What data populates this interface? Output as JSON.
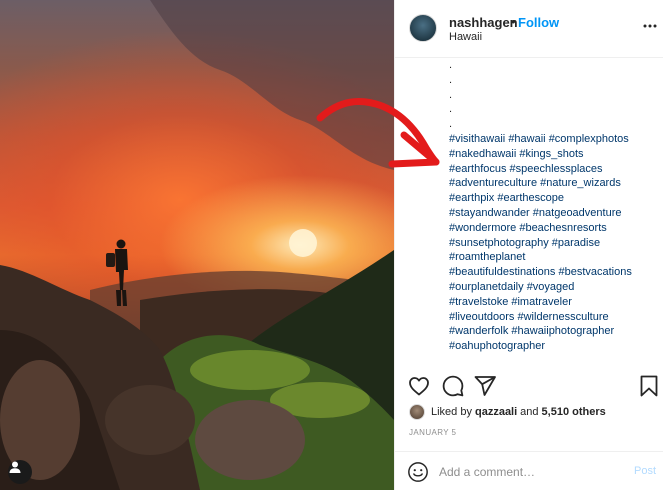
{
  "post": {
    "photo_icon": "user-icon",
    "header": {
      "username": "nashhagen",
      "separator": "•",
      "follow_label": "Follow",
      "location": "Hawaii",
      "more_icon": "more-horizontal-icon"
    },
    "caption": {
      "bullets": [
        ".",
        ".",
        ".",
        ".",
        "."
      ],
      "hashtag_lines": [
        [
          "#visithawaii",
          "#hawaii",
          "#complexphotos"
        ],
        [
          "#nakedhawaii",
          "#kings_shots"
        ],
        [
          "#earthfocus",
          "#speechlessplaces"
        ],
        [
          "#adventureculture",
          "#nature_wizards"
        ],
        [
          "#earthpix",
          "#earthescope"
        ],
        [
          "#stayandwander",
          "#natgeoadventure"
        ],
        [
          "#wondermore",
          "#beachesnresorts"
        ],
        [
          "#sunsetphotography",
          "#paradise"
        ],
        [
          "#roamtheplanet"
        ],
        [
          "#beautifuldestinations",
          "#bestvacations"
        ],
        [
          "#ourplanetdaily",
          "#voyaged"
        ],
        [
          "#travelstoke",
          "#imatraveler"
        ],
        [
          "#liveoutdoors",
          "#wildernessculture"
        ],
        [
          "#wanderfolk",
          "#hawaiiphotographer"
        ],
        [
          "#oahuphotographer"
        ]
      ]
    },
    "actions": {
      "like_icon": "heart-icon",
      "comment_icon": "comment-icon",
      "share_icon": "send-icon",
      "save_icon": "bookmark-icon"
    },
    "likes": {
      "prefix": "Liked by",
      "user": "qazzaali",
      "joiner": "and",
      "others": "5,510 others"
    },
    "date": "JANUARY 5",
    "comment": {
      "emoji_icon": "smiley-icon",
      "placeholder": "Add a comment…",
      "post_label": "Post"
    }
  },
  "colors": {
    "link": "#00376b",
    "follow": "#0095f6",
    "post_disabled": "#b3dbff",
    "muted": "#8e8e8e",
    "arrow_annotation": "#e31b1b"
  }
}
